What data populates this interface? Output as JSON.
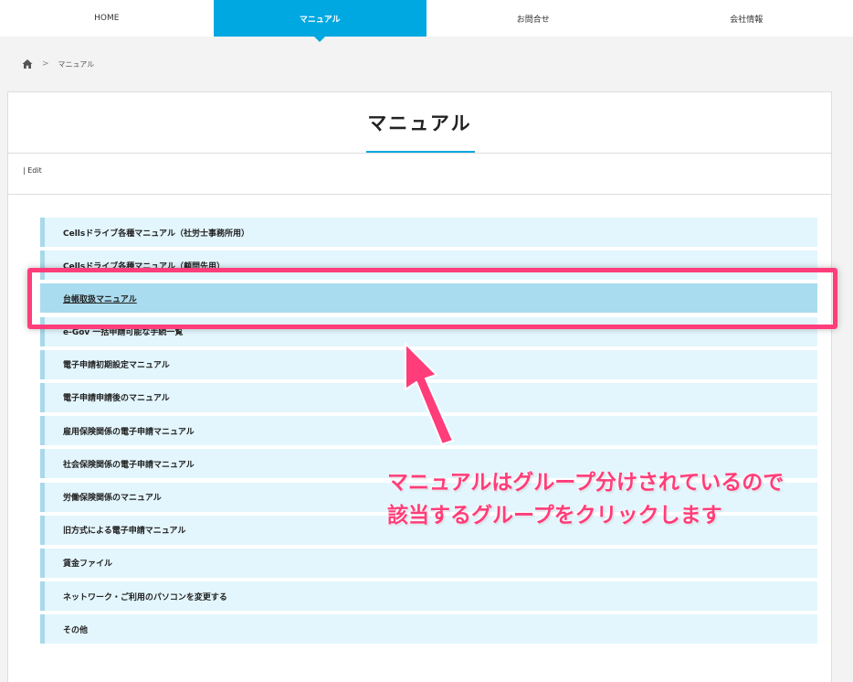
{
  "nav": {
    "items": [
      {
        "label": "HOME"
      },
      {
        "label": "マニュアル"
      },
      {
        "label": "お問合せ"
      },
      {
        "label": "会社情報"
      }
    ]
  },
  "breadcrumb": {
    "home_icon": "home-icon",
    "separator": ">",
    "current": "マニュアル"
  },
  "page": {
    "title": "マニュアル",
    "edit_link": "| Edit"
  },
  "manuals": {
    "items": [
      {
        "label": "Cellsドライブ各種マニュアル（社労士事務所用）"
      },
      {
        "label": "Cellsドライブ各種マニュアル（顧問先用）"
      },
      {
        "label": "台帳取扱マニュアル"
      },
      {
        "label": "e-Gov 一括申請可能な手続一覧"
      },
      {
        "label": "電子申請初期設定マニュアル"
      },
      {
        "label": "電子申請申請後のマニュアル"
      },
      {
        "label": "雇用保険関係の電子申請マニュアル"
      },
      {
        "label": "社会保険関係の電子申請マニュアル"
      },
      {
        "label": "労働保険関係のマニュアル"
      },
      {
        "label": "旧方式による電子申請マニュアル"
      },
      {
        "label": "賃金ファイル"
      },
      {
        "label": "ネットワーク・ご利用のパソコンを変更する"
      },
      {
        "label": "その他"
      }
    ]
  },
  "annotation": {
    "line1": "マニュアルはグループ分けされているので",
    "line2": "該当するグループをクリックします",
    "color": "#ff3d7a"
  },
  "colors": {
    "accent": "#00a8e1",
    "list_bg": "#e3f6fd",
    "list_bar": "#a9d9ea",
    "highlight_bg": "#a9dcee"
  }
}
